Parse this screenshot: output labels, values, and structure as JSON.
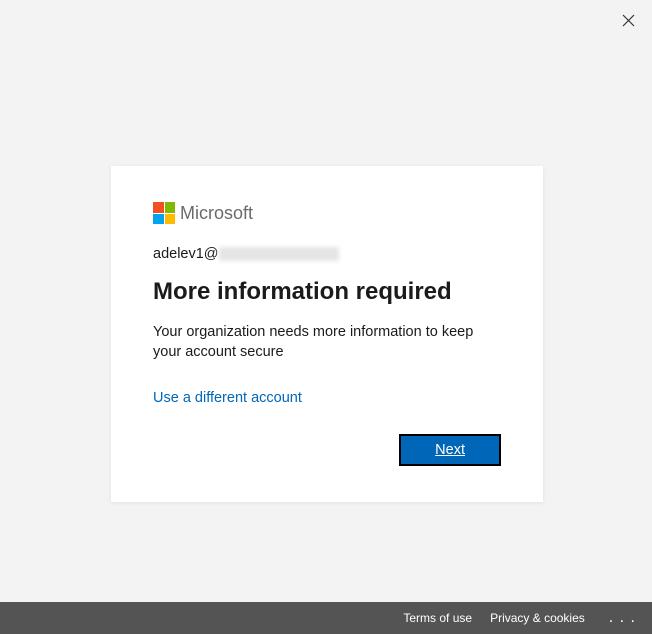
{
  "brand": {
    "name": "Microsoft"
  },
  "account": {
    "email_prefix": "adelev1@"
  },
  "content": {
    "heading": "More information required",
    "body": "Your organization needs more information to keep your account secure"
  },
  "links": {
    "use_different": "Use a different account"
  },
  "buttons": {
    "next": "Next"
  },
  "footer": {
    "terms": "Terms of use",
    "privacy": "Privacy & cookies"
  }
}
